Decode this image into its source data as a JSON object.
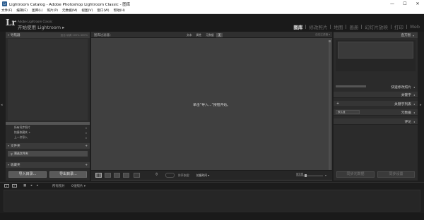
{
  "window": {
    "title": "Lightroom Catalog - Adobe Photoshop Lightroom Classic - 图库",
    "app_icon": "Lr",
    "controls": [
      "—",
      "☐",
      "✕"
    ]
  },
  "menu": [
    "文件(F)",
    "编辑(E)",
    "图库(L)",
    "照片(P)",
    "元数据(M)",
    "视图(V)",
    "窗口(W)",
    "帮助(H)"
  ],
  "identity": {
    "logo": "Lr",
    "line1": "Adobe Lightroom Classic",
    "line2": "开始使用 Lightroom ▸"
  },
  "modules": [
    {
      "label": "图库",
      "active": true
    },
    {
      "label": "修改照片",
      "active": false
    },
    {
      "label": "地图",
      "active": false
    },
    {
      "label": "画册",
      "active": false
    },
    {
      "label": "幻灯片放映",
      "active": false
    },
    {
      "label": "打印",
      "active": false
    },
    {
      "label": "Web",
      "active": false
    }
  ],
  "left_panel": {
    "navigator": {
      "title": "导航器",
      "options": "适合  填满  100%  400%"
    },
    "catalog_rows": [
      {
        "label": "所有同步照片",
        "count": "0"
      },
      {
        "label": "快捷收藏夹 +",
        "count": "0"
      },
      {
        "label": "上一次导入",
        "count": "0"
      }
    ],
    "folders": {
      "title": "文件夹",
      "plus": "+",
      "filter": "筛选文件夹"
    },
    "collections": {
      "title": "收藏夹",
      "plus": "+"
    },
    "import_button": "导入目录...",
    "export_button": "导出目录..."
  },
  "center": {
    "filter_label": "图库过滤器：",
    "filter_buttons": [
      {
        "label": "文本",
        "active": false
      },
      {
        "label": "属性",
        "active": false
      },
      {
        "label": "元数据",
        "active": false
      },
      {
        "label": "无",
        "active": true
      }
    ],
    "filter_right": "自定过滤器 ▾",
    "empty_message": "单击“导入...”按钮开始。"
  },
  "toolbar": {
    "sort_label": "排序依据：",
    "sort_value": "拍摄时间 ▾",
    "thumb_label": "缩览图"
  },
  "right_panel": {
    "histogram": "直方图",
    "quick_develop": "快速修改照片",
    "keywording": "关键字",
    "keyword_list": "关键字列表",
    "metadata": "元数据",
    "metadata_preset": "默认值",
    "comments": "评论",
    "sync_metadata": "同步元数据",
    "sync_settings": "同步设置"
  },
  "filmstrip_bar": {
    "page1": "1",
    "page2": "2",
    "all_photos": "所有照片",
    "count": "0张照片 ▾"
  }
}
